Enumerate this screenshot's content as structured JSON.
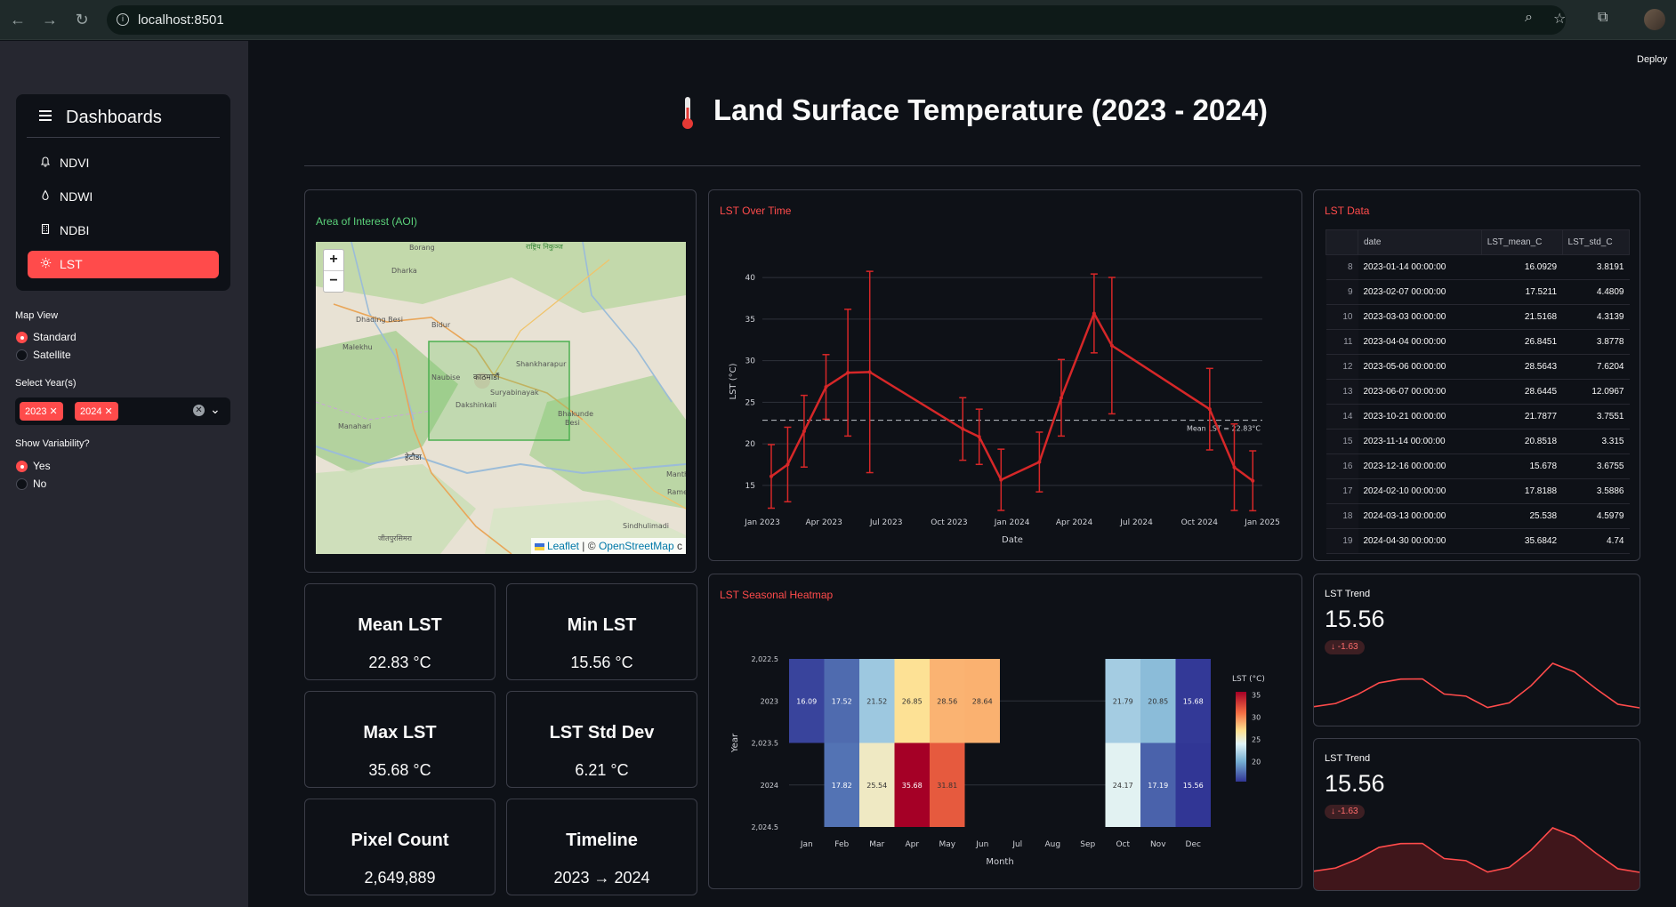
{
  "browser": {
    "url": "localhost:8501"
  },
  "app": {
    "deploy_label": "Deploy",
    "title": "Land Surface Temperature (2023 - 2024)"
  },
  "sidebar": {
    "nav_title": "Dashboards",
    "items": [
      {
        "label": "NDVI",
        "icon": "bell-icon"
      },
      {
        "label": "NDWI",
        "icon": "droplet-icon"
      },
      {
        "label": "NDBI",
        "icon": "building-icon"
      },
      {
        "label": "LST",
        "icon": "sun-icon",
        "active": true
      }
    ],
    "map_view": {
      "label": "Map View",
      "options": [
        "Standard",
        "Satellite"
      ],
      "selected": "Standard"
    },
    "years": {
      "label": "Select Year(s)",
      "selected": [
        "2023",
        "2024"
      ]
    },
    "variability": {
      "label": "Show Variability?",
      "options": [
        "Yes",
        "No"
      ],
      "selected": "Yes"
    }
  },
  "map_card": {
    "title": "Area of Interest (AOI)",
    "zoom_in": "+",
    "zoom_out": "−",
    "attribution_leaflet": "Leaflet",
    "attribution_sep": " | © ",
    "attribution_osm": "OpenStreetMap",
    "attribution_tail": " c",
    "places": [
      "Borang",
      "Dharka",
      "Dhading Besi",
      "Bidur",
      "Malekhu",
      "Naubise",
      "काठमाडौं",
      "Shankharapur",
      "Suryabinayak",
      "Dakshinkali",
      "Bhakunde Besi",
      "Manahari",
      "हेटौडा",
      "जीतपुरसिमरा",
      "Sindhulimadi",
      "Manth",
      "Rame"
    ]
  },
  "metrics": [
    {
      "label": "Mean LST",
      "value": "22.83 °C"
    },
    {
      "label": "Min LST",
      "value": "15.56 °C"
    },
    {
      "label": "Max LST",
      "value": "35.68 °C"
    },
    {
      "label": "LST Std Dev",
      "value": "6.21 °C"
    },
    {
      "label": "Pixel Count",
      "value": "2,649,889"
    },
    {
      "label": "Timeline",
      "value": "2023 → 2024"
    }
  ],
  "line_card": {
    "title": "LST Over Time",
    "mean_label": "Mean LST = 22.83°C"
  },
  "heat_card": {
    "title": "LST Seasonal Heatmap"
  },
  "table_card": {
    "title": "LST Data",
    "columns": [
      "",
      "date",
      "LST_mean_C",
      "LST_std_C"
    ],
    "rows": [
      [
        "8",
        "2023-01-14 00:00:00",
        "16.0929",
        "3.8191"
      ],
      [
        "9",
        "2023-02-07 00:00:00",
        "17.5211",
        "4.4809"
      ],
      [
        "10",
        "2023-03-03 00:00:00",
        "21.5168",
        "4.3139"
      ],
      [
        "11",
        "2023-04-04 00:00:00",
        "26.8451",
        "3.8778"
      ],
      [
        "12",
        "2023-05-06 00:00:00",
        "28.5643",
        "7.6204"
      ],
      [
        "13",
        "2023-06-07 00:00:00",
        "28.6445",
        "12.0967"
      ],
      [
        "14",
        "2023-10-21 00:00:00",
        "21.7877",
        "3.7551"
      ],
      [
        "15",
        "2023-11-14 00:00:00",
        "20.8518",
        "3.315"
      ],
      [
        "16",
        "2023-12-16 00:00:00",
        "15.678",
        "3.6755"
      ],
      [
        "17",
        "2024-02-10 00:00:00",
        "17.8188",
        "3.5886"
      ],
      [
        "18",
        "2024-03-13 00:00:00",
        "25.538",
        "4.5979"
      ],
      [
        "19",
        "2024-04-30 00:00:00",
        "35.6842",
        "4.74"
      ]
    ]
  },
  "trends": [
    {
      "label": "LST Trend",
      "value": "15.56",
      "delta": "↓ -1.63",
      "kind": "line"
    },
    {
      "label": "LST Trend",
      "value": "15.56",
      "delta": "↓ -1.63",
      "kind": "area"
    }
  ],
  "chart_data": [
    {
      "type": "line",
      "title": "LST Over Time",
      "xlabel": "Date",
      "ylabel": "LST (°C)",
      "ylim": [
        12,
        43
      ],
      "yticks": [
        15,
        20,
        25,
        30,
        35,
        40
      ],
      "xticks": [
        "Jan 2023",
        "Apr 2023",
        "Jul 2023",
        "Oct 2023",
        "Jan 2024",
        "Apr 2024",
        "Jul 2024",
        "Oct 2024",
        "Jan 2025"
      ],
      "xtick_dates": [
        "2023-01-01",
        "2023-04-01",
        "2023-07-01",
        "2023-10-01",
        "2024-01-01",
        "2024-04-01",
        "2024-07-01",
        "2024-10-01",
        "2025-01-01"
      ],
      "x": [
        "2023-01-14",
        "2023-02-07",
        "2023-03-03",
        "2023-04-04",
        "2023-05-06",
        "2023-06-07",
        "2023-10-21",
        "2023-11-14",
        "2023-12-16",
        "2024-02-10",
        "2024-03-13",
        "2024-04-30",
        "2024-05-26",
        "2024-10-16",
        "2024-11-21",
        "2024-12-18"
      ],
      "y": [
        16.09,
        17.52,
        21.52,
        26.85,
        28.56,
        28.64,
        21.79,
        20.85,
        15.68,
        17.82,
        25.54,
        35.68,
        31.81,
        24.17,
        17.19,
        15.56
      ],
      "err": [
        3.82,
        4.48,
        4.31,
        3.88,
        7.62,
        12.1,
        3.76,
        3.32,
        3.68,
        3.59,
        4.6,
        4.74,
        8.2,
        4.9,
        5.2,
        3.6
      ],
      "mean_line": 22.83,
      "color": "#d62728",
      "grid": true
    },
    {
      "type": "heatmap",
      "title": "LST Seasonal Heatmap",
      "xlabel": "Month",
      "ylabel": "Year",
      "colorbar_label": "LST (°C)",
      "colorbar_ticks": [
        20,
        25,
        30,
        35
      ],
      "zrange": [
        15.56,
        35.68
      ],
      "categories": [
        "Jan",
        "Feb",
        "Mar",
        "Apr",
        "May",
        "Jun",
        "Jul",
        "Aug",
        "Sep",
        "Oct",
        "Nov",
        "Dec"
      ],
      "years": [
        "2023",
        "2024"
      ],
      "yticks": [
        "2,022.5",
        "2023",
        "2,023.5",
        "2024",
        "2,024.5"
      ],
      "values": [
        [
          16.09,
          17.52,
          21.52,
          26.85,
          28.56,
          28.64,
          null,
          null,
          null,
          21.79,
          20.85,
          15.68
        ],
        [
          null,
          17.82,
          25.54,
          35.68,
          31.81,
          null,
          null,
          null,
          null,
          24.17,
          17.19,
          15.56
        ]
      ]
    }
  ]
}
